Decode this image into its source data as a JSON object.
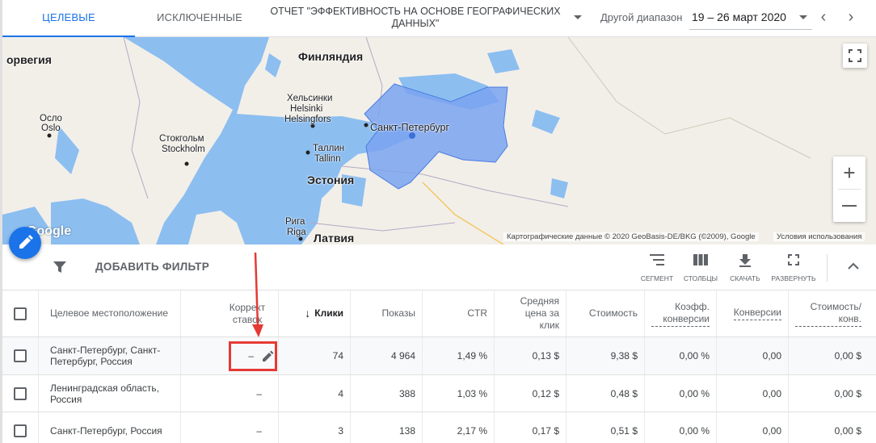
{
  "tabs": [
    {
      "label": "ЦЕЛЕВЫЕ",
      "active": true
    },
    {
      "label": "ИСКЛЮЧЕННЫЕ",
      "active": false
    }
  ],
  "report": {
    "title": "ОТЧЕТ \"ЭФФЕКТИВНОСТЬ НА ОСНОВЕ ГЕОГРАФИЧЕСКИХ ДАННЫХ\""
  },
  "date_range": {
    "label": "Другой диапазон",
    "value": "19 – 26 март 2020"
  },
  "map": {
    "labels": {
      "norway": "орвегия",
      "finland": "Финляндия",
      "helsinki_ru": "Хельсинки",
      "helsinki": "Helsinki",
      "helsingfors": "Helsingfors",
      "oslo_ru": "Осло",
      "oslo": "Oslo",
      "stockholm_ru": "Стокгольм",
      "stockholm": "Stockholm",
      "tallinn_ru": "Таллин",
      "tallinn": "Tallinn",
      "estonia": "Эстония",
      "riga_ru": "Рига",
      "riga": "Riga",
      "latvia": "Латвия",
      "spb": "Санкт-Петербург"
    },
    "google_logo": "Google",
    "attribution": "Картографические данные © 2020 GeoBasis-DE/BKG (©2009), Google",
    "terms": "Условия использования",
    "zoom_in": "+",
    "zoom_out": "—"
  },
  "toolbar": {
    "add_filter": "ДОБАВИТЬ ФИЛЬТР",
    "segment": "СЕГМЕНТ",
    "columns": "СТОЛБЦЫ",
    "download": "СКАЧАТЬ",
    "expand": "РАЗВЕРНУТЬ"
  },
  "table": {
    "headers": {
      "location": "Целевое местоположение",
      "bid_adj": "Коррект ставок",
      "clicks": "Клики",
      "impressions": "Показы",
      "ctr": "CTR",
      "avg_cpc": "Средняя цена за клик",
      "cost": "Стоимость",
      "conv_rate": "Коэфф. конверсии",
      "conversions": "Конверсии",
      "cost_conv": "Стоимость/ конв."
    },
    "rows": [
      {
        "location": "Санкт-Петербург, Санкт-Петербург, Россия",
        "bid_adj": "–",
        "clicks": "74",
        "impressions": "4 964",
        "ctr": "1,49 %",
        "avg_cpc": "0,13 $",
        "cost": "9,38 $",
        "conv_rate": "0,00 %",
        "conversions": "0,00",
        "cost_conv": "0,00 $"
      },
      {
        "location": "Ленинградская область, Россия",
        "bid_adj": "–",
        "clicks": "4",
        "impressions": "388",
        "ctr": "1,03 %",
        "avg_cpc": "0,12 $",
        "cost": "0,48 $",
        "conv_rate": "0,00 %",
        "conversions": "0,00",
        "cost_conv": "0,00 $"
      },
      {
        "location": "Санкт-Петербург, Россия",
        "bid_adj": "–",
        "clicks": "3",
        "impressions": "138",
        "ctr": "2,17 %",
        "avg_cpc": "0,17 $",
        "cost": "0,51 $",
        "conv_rate": "0,00 %",
        "conversions": "0,00",
        "cost_conv": "0,00 $"
      }
    ]
  },
  "colors": {
    "accent": "#1a73e8",
    "annotation": "#e53935",
    "water": "#84b8eb",
    "region": "#7aa3f0"
  }
}
